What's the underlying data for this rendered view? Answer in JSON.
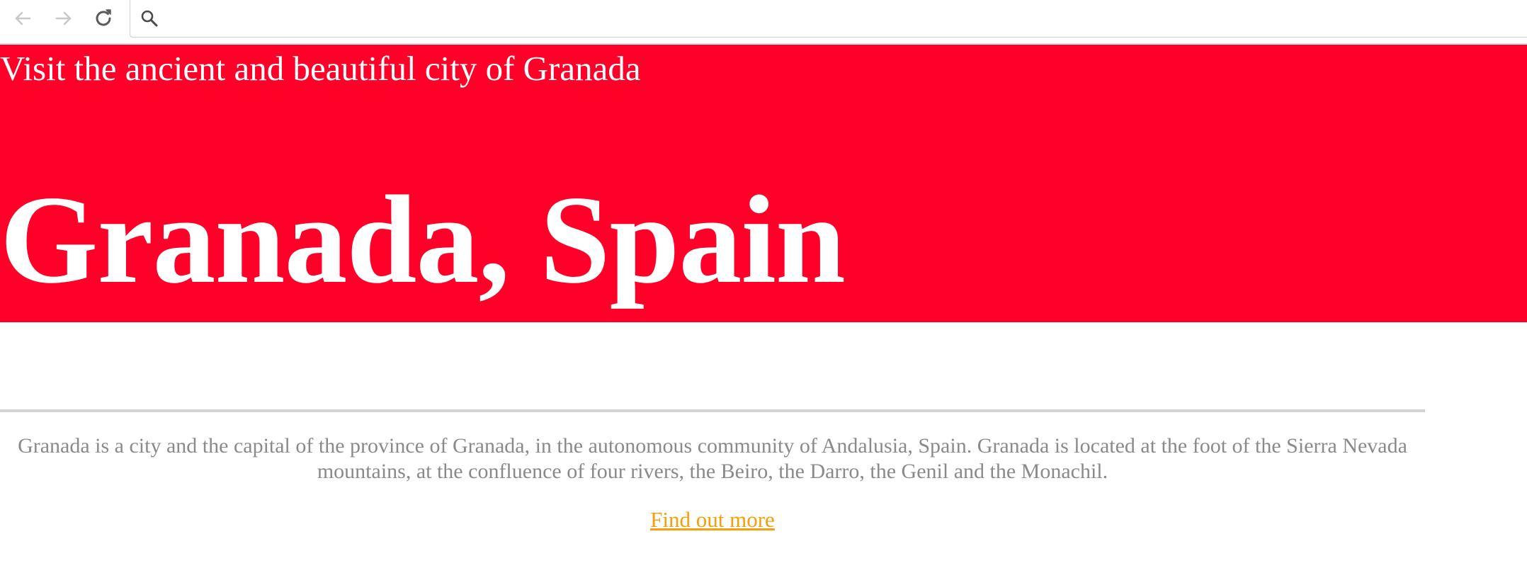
{
  "browser": {
    "back_icon": "arrow-left-icon",
    "forward_icon": "arrow-right-icon",
    "reload_icon": "reload-icon",
    "search_icon": "search-icon",
    "address_value": "",
    "address_placeholder": ""
  },
  "hero": {
    "tagline": "Visit the ancient and beautiful city of Granada",
    "title": "Granada, Spain",
    "background_color": "#ff0029",
    "text_color": "#ffffff"
  },
  "content": {
    "description": "Granada is a city and the capital of the province of Granada, in the autonomous community of Andalusia, Spain. Granada is located at the foot of the Sierra Nevada mountains, at the confluence of four rivers, the Beiro, the Darro, the Genil and the Monachil.",
    "link_label": "Find out more",
    "link_color": "#f5a00a",
    "text_color": "#8a8a8a"
  }
}
